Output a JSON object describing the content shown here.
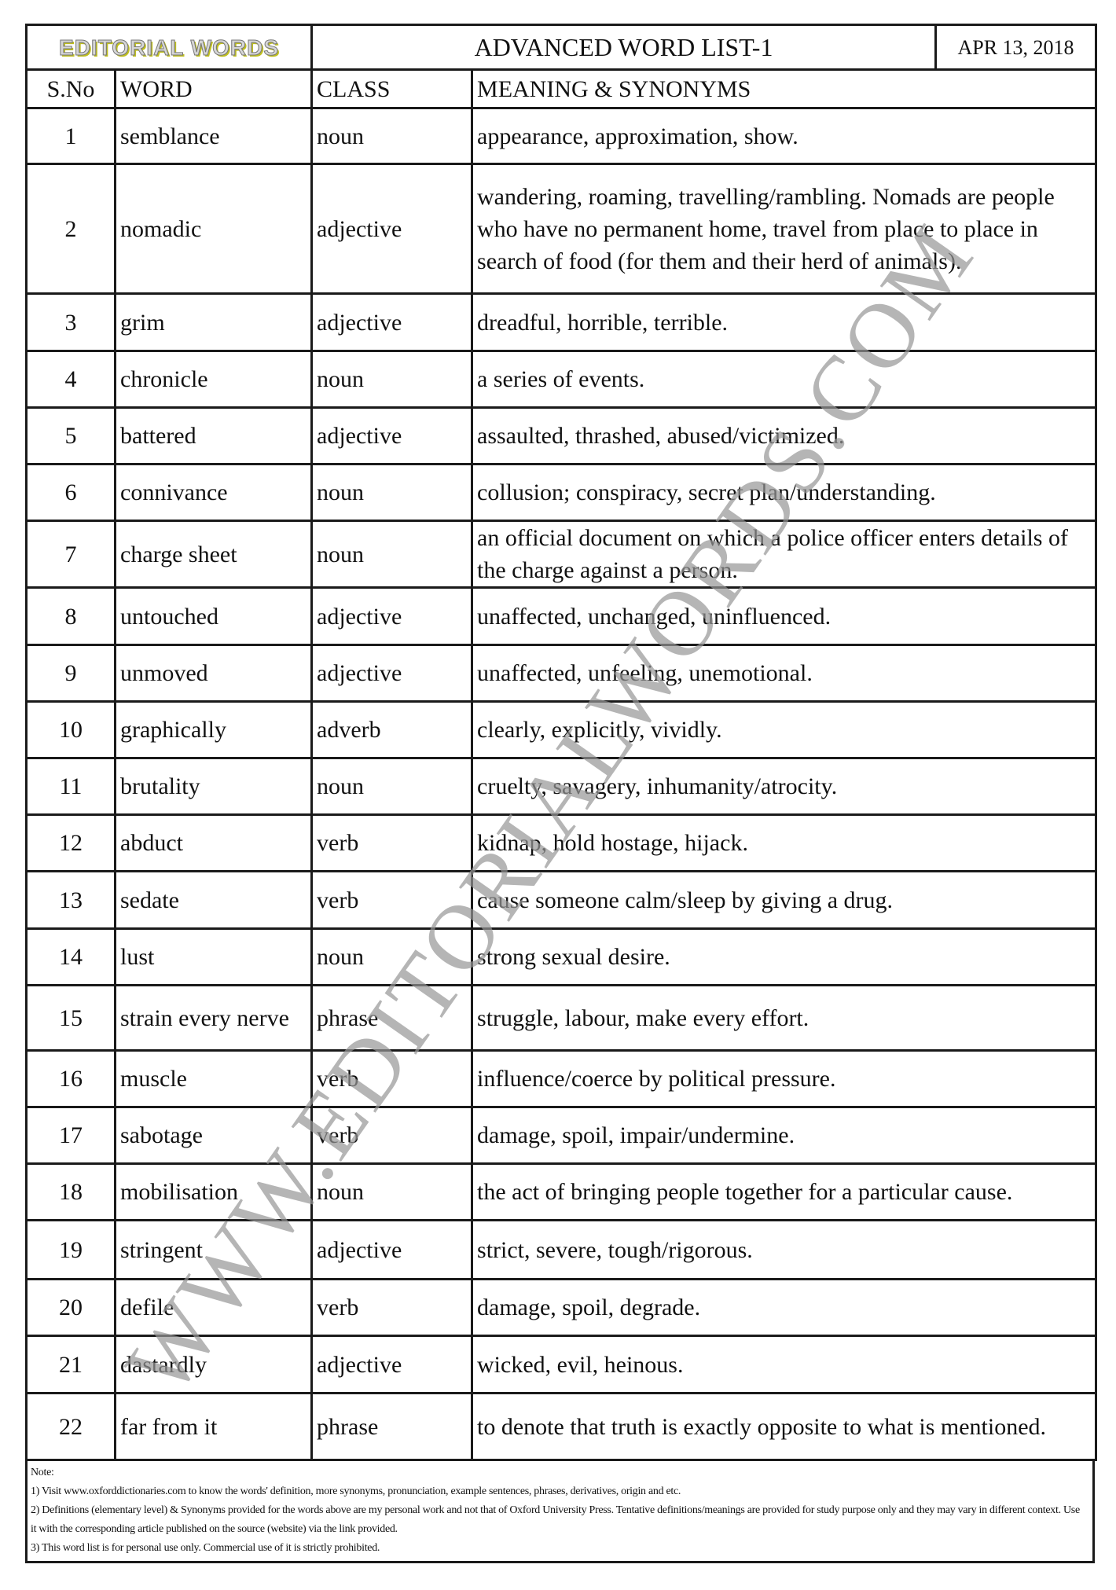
{
  "header": {
    "logo_text": "EDITORIAL WORDS",
    "title": "ADVANCED WORD LIST-1",
    "date": "APR 13, 2018"
  },
  "columns": {
    "sno": "S.No",
    "word": "WORD",
    "class": "CLASS",
    "meaning": "MEANING & SYNONYMS"
  },
  "rows": [
    {
      "sno": "1",
      "word": "semblance",
      "class": "noun",
      "meaning": "appearance, approximation, show."
    },
    {
      "sno": "2",
      "word": "nomadic",
      "class": "adjective",
      "meaning": "wandering, roaming, travelling/rambling. Nomads are people who have no permanent home, travel from place to place in search of food (for them and their herd of animals)."
    },
    {
      "sno": "3",
      "word": "grim",
      "class": "adjective",
      "meaning": "dreadful, horrible, terrible."
    },
    {
      "sno": "4",
      "word": "chronicle",
      "class": "noun",
      "meaning": "a series of events."
    },
    {
      "sno": "5",
      "word": "battered",
      "class": "adjective",
      "meaning": "assaulted, thrashed, abused/victimized."
    },
    {
      "sno": "6",
      "word": "connivance",
      "class": "noun",
      "meaning": "collusion; conspiracy, secret plan/understanding."
    },
    {
      "sno": "7",
      "word": "charge sheet",
      "class": "noun",
      "meaning": "an official document on which a police officer enters details of the charge against a person."
    },
    {
      "sno": "8",
      "word": "untouched",
      "class": "adjective",
      "meaning": "unaffected, unchanged, uninfluenced."
    },
    {
      "sno": "9",
      "word": "unmoved",
      "class": "adjective",
      "meaning": "unaffected, unfeeling, unemotional."
    },
    {
      "sno": "10",
      "word": "graphically",
      "class": "adverb",
      "meaning": "clearly, explicitly, vividly."
    },
    {
      "sno": "11",
      "word": "brutality",
      "class": "noun",
      "meaning": "cruelty, savagery, inhumanity/atrocity."
    },
    {
      "sno": "12",
      "word": "abduct",
      "class": "verb",
      "meaning": "kidnap, hold hostage, hijack."
    },
    {
      "sno": "13",
      "word": "sedate",
      "class": "verb",
      "meaning": "cause someone calm/sleep by giving a drug."
    },
    {
      "sno": "14",
      "word": "lust",
      "class": "noun",
      "meaning": "strong sexual desire."
    },
    {
      "sno": "15",
      "word": "strain every nerve",
      "class": "phrase",
      "meaning": "struggle, labour, make every effort."
    },
    {
      "sno": "16",
      "word": "muscle",
      "class": "verb",
      "meaning": "influence/coerce by political pressure."
    },
    {
      "sno": "17",
      "word": "sabotage",
      "class": "verb",
      "meaning": "damage, spoil, impair/undermine."
    },
    {
      "sno": "18",
      "word": "mobilisation",
      "class": "noun",
      "meaning": "the act of bringing people together for a particular cause."
    },
    {
      "sno": "19",
      "word": "stringent",
      "class": "adjective",
      "meaning": "strict, severe, tough/rigorous."
    },
    {
      "sno": "20",
      "word": "defile",
      "class": "verb",
      "meaning": "damage, spoil, degrade."
    },
    {
      "sno": "21",
      "word": "dastardly",
      "class": "adjective",
      "meaning": "wicked, evil, heinous."
    },
    {
      "sno": "22",
      "word": "far from it",
      "class": "phrase",
      "meaning": "to denote that truth is exactly opposite to what is mentioned."
    }
  ],
  "notes": {
    "heading": "Note:",
    "items": [
      "1) Visit www.oxforddictionaries.com to know the words' definition, more synonyms, pronunciation, example sentences, phrases, derivatives, origin and etc.",
      "2) Definitions (elementary level) & Synonyms provided for the words above are my personal work and not that of Oxford University Press. Tentative definitions/meanings are provided for study purpose only and they may vary in different context. Use it with the corresponding article published on the source (website) via the link provided.",
      "3) This word list is for personal use only. Commercial use of it is strictly prohibited."
    ]
  },
  "watermark": "WWW.EDITORIALWORDS.COM"
}
